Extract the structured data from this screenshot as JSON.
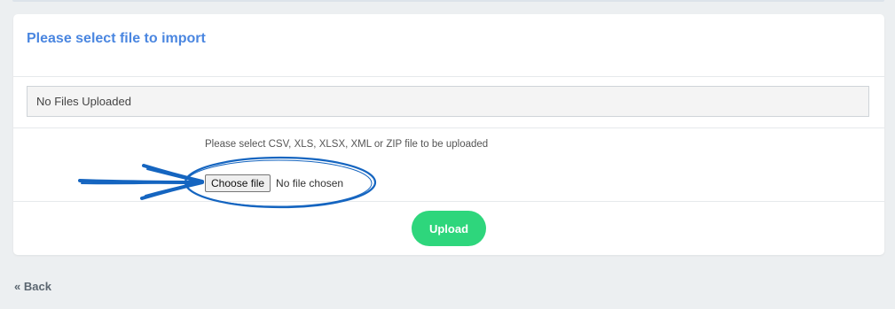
{
  "card": {
    "title": "Please select file to import",
    "uploaded_status": "No Files Uploaded",
    "hint": "Please select CSV, XLS, XLSX, XML or ZIP file to be uploaded",
    "choose_file_label": "Choose file",
    "no_file_text": "No file chosen",
    "upload_label": "Upload"
  },
  "nav": {
    "back_label": "« Back"
  },
  "colors": {
    "title": "#4a86e0",
    "upload_button": "#2ed67c",
    "annotation": "#1565c0",
    "background": "#eceff1"
  },
  "annotation": {
    "icons": [
      "arrow-icon",
      "ellipse-highlight"
    ]
  }
}
